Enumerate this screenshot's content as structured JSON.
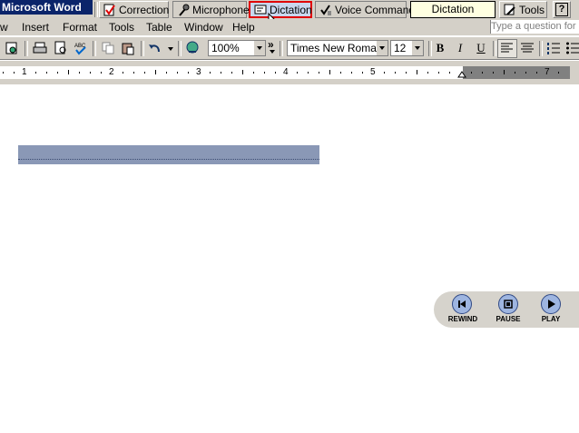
{
  "app": {
    "title": "Microsoft Word"
  },
  "language_bar": {
    "correction": "Correction",
    "microphone": "Microphone",
    "dictation": "Dictation",
    "voice_command": "Voice Command",
    "status": "Dictation",
    "tools": "Tools",
    "help": "?"
  },
  "menu": {
    "items": [
      "w",
      "Insert",
      "Format",
      "Tools",
      "Table",
      "Window",
      "Help"
    ],
    "ask_placeholder": "Type a question for"
  },
  "toolbar": {
    "zoom": "100%",
    "font": "Times New Roman",
    "size": "12",
    "bold": "B",
    "italic": "I",
    "underline": "U",
    "more": "»"
  },
  "ruler": {
    "numbers": [
      "1",
      "2",
      "3",
      "4",
      "5",
      "7"
    ]
  },
  "playback": {
    "rewind": "REWIND",
    "pause": "PAUSE",
    "play": "PLAY"
  },
  "colors": {
    "title_bar": "#0a246a",
    "dictation_bubble": "#8a98b6",
    "highlight": "#e00000"
  }
}
